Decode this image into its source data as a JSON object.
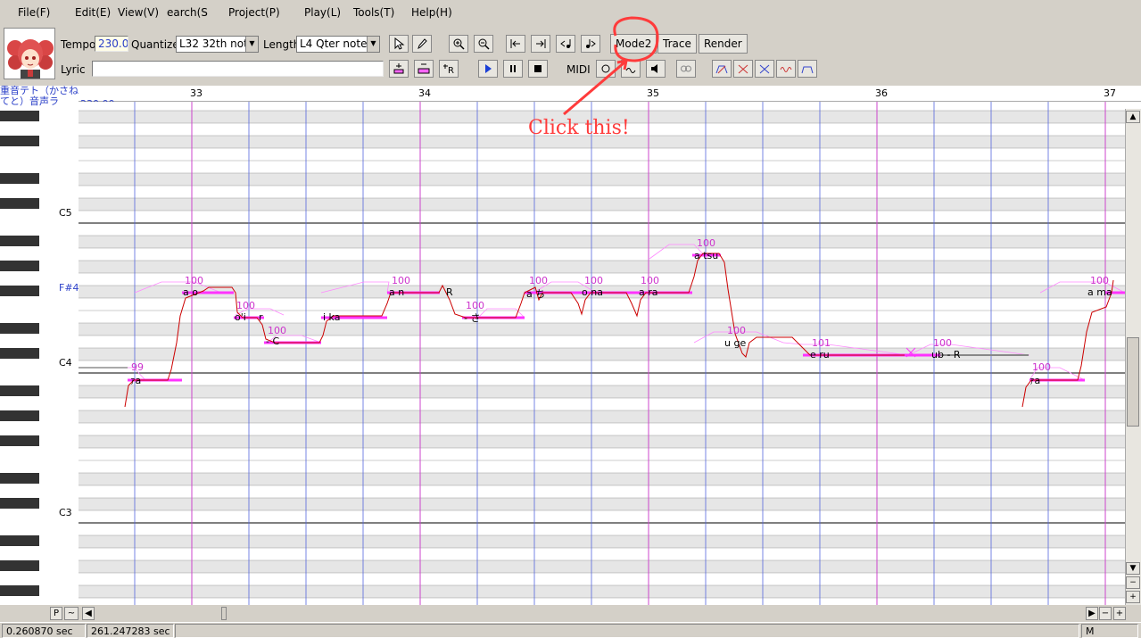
{
  "menu": [
    "File(F)",
    "Edit(E)",
    "View(V)",
    "earch(S",
    "Project(P)",
    "Play(L)",
    "Tools(T)",
    "Help(H)"
  ],
  "toolbar": {
    "tempo_label": "Tempo",
    "tempo_value": "230.0",
    "quantize_label": "Quantize",
    "quantize_value": "L32 32th note",
    "length_label": "Length",
    "length_value": "L4  Qter note",
    "lyric_label": "Lyric",
    "lyric_value": "",
    "mode_button": "Mode2",
    "trace_button": "Trace",
    "render_button": "Render",
    "midi_label": "MIDI"
  },
  "editor": {
    "singer_name": "重音テト（かさねてと）音声ラ",
    "tempo_marker": "230.00",
    "measures": [
      "33",
      "34",
      "35",
      "36",
      "37"
    ],
    "pitch_labels": [
      "C5",
      "F#4",
      "C4",
      "C3"
    ],
    "notes": [
      {
        "lyric": "ｧa",
        "velocity": "99"
      },
      {
        "lyric": "a o",
        "velocity": "100"
      },
      {
        "lyric": "o'i",
        "velocity": "100"
      },
      {
        "lyric": "r",
        "velocity": ""
      },
      {
        "lyric": "- C",
        "velocity": "100"
      },
      {
        "lyric": "i ka",
        "velocity": ""
      },
      {
        "lyric": "a n",
        "velocity": "100"
      },
      {
        "lyric": "R",
        "velocity": ""
      },
      {
        "lyric": "- さ",
        "velocity": "100"
      },
      {
        "lyric": "a ち",
        "velocity": "100"
      },
      {
        "lyric": "o na",
        "velocity": "100"
      },
      {
        "lyric": "a ra",
        "velocity": "100"
      },
      {
        "lyric": "a tsu",
        "velocity": "100"
      },
      {
        "lyric": "u ge",
        "velocity": "100"
      },
      {
        "lyric": "e ru",
        "velocity": "101"
      },
      {
        "lyric": "ub - R",
        "velocity": "100"
      },
      {
        "lyric": "ｧa",
        "velocity": "100"
      },
      {
        "lyric": "a ma",
        "velocity": "100"
      }
    ]
  },
  "annotation": "Click this!",
  "status": {
    "time1": "0.260870 sec",
    "time2": "261.247283 sec",
    "mode": "M"
  },
  "bottom": {
    "p_button": "P",
    "tilde_button": "~"
  },
  "colors": {
    "note": "#ff33ff",
    "pitch_curve": "#cc0000",
    "measure_line": "#cc44cc",
    "beat_line": "#5566dd",
    "annotation": "#ff3b3b"
  }
}
